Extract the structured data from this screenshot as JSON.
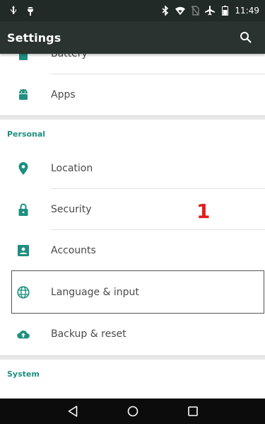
{
  "status_bar": {
    "time": "11:49",
    "left_icons": [
      "usb-icon",
      "android-debug-icon"
    ],
    "right_icons": [
      "bluetooth-icon",
      "wifi-icon",
      "no-sim-icon",
      "airplane-mode-icon",
      "battery-icon"
    ]
  },
  "action_bar": {
    "title": "Settings",
    "search_icon": "search-icon"
  },
  "device_items": [
    {
      "label": "Battery",
      "icon": "battery-icon"
    },
    {
      "label": "Apps",
      "icon": "android-icon"
    }
  ],
  "personal": {
    "header": "Personal",
    "items": [
      {
        "label": "Location",
        "icon": "location-pin-icon"
      },
      {
        "label": "Security",
        "icon": "lock-icon"
      },
      {
        "label": "Accounts",
        "icon": "account-card-icon"
      },
      {
        "label": "Language & input",
        "icon": "globe-icon"
      },
      {
        "label": "Backup & reset",
        "icon": "cloud-upload-icon"
      }
    ]
  },
  "system": {
    "header": "System"
  },
  "annotation": {
    "step_number": "1"
  },
  "nav_bar": {
    "buttons": [
      "back-icon",
      "home-icon",
      "recents-icon"
    ]
  },
  "colors": {
    "accent": "#1e8f80",
    "icon_teal": "#1e8f80",
    "action_bar": "#2a332f",
    "status_bar": "#222a27",
    "annotation_red": "#e01f1f"
  }
}
